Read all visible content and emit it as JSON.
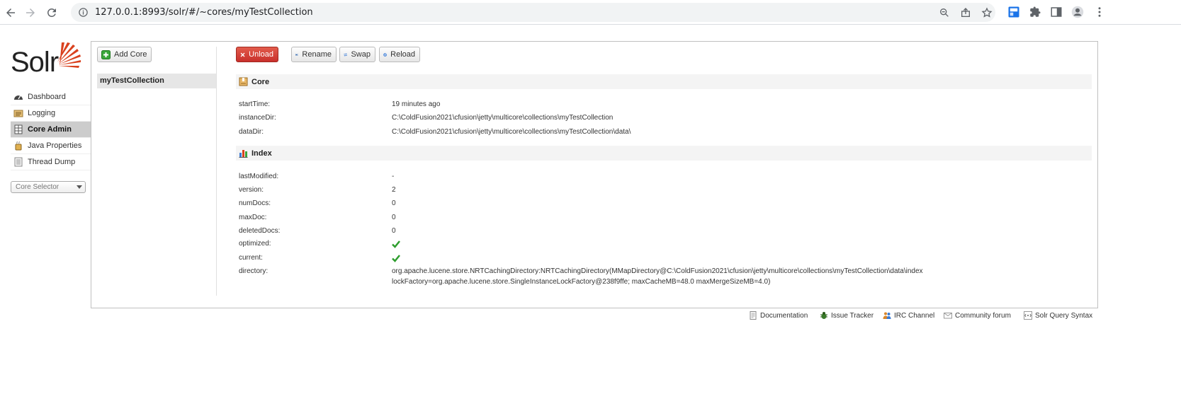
{
  "browser": {
    "url": "127.0.0.1:8993/solr/#/~cores/myTestCollection"
  },
  "logo": {
    "text": "Solr"
  },
  "menu": {
    "items": [
      {
        "label": "Dashboard",
        "icon": "dashboard-icon"
      },
      {
        "label": "Logging",
        "icon": "logging-icon"
      },
      {
        "label": "Core Admin",
        "icon": "core-admin-icon",
        "active": true
      },
      {
        "label": "Java Properties",
        "icon": "java-icon"
      },
      {
        "label": "Thread Dump",
        "icon": "thread-dump-icon"
      }
    ],
    "core_selector": "Core Selector"
  },
  "toolbar": {
    "add_core": "Add Core",
    "unload": "Unload",
    "rename": "Rename",
    "swap": "Swap",
    "reload": "Reload"
  },
  "cores": [
    "myTestCollection"
  ],
  "core_section": {
    "title": "Core",
    "rows": [
      {
        "key": "startTime:",
        "value": "19 minutes ago"
      },
      {
        "key": "instanceDir:",
        "value": "C:\\ColdFusion2021\\cfusion\\jetty\\multicore\\collections\\myTestCollection"
      },
      {
        "key": "dataDir:",
        "value": "C:\\ColdFusion2021\\cfusion\\jetty\\multicore\\collections\\myTestCollection\\data\\"
      }
    ]
  },
  "index_section": {
    "title": "Index",
    "rows": [
      {
        "key": "lastModified:",
        "value": "-"
      },
      {
        "key": "version:",
        "value": "2"
      },
      {
        "key": "numDocs:",
        "value": "0"
      },
      {
        "key": "maxDoc:",
        "value": "0"
      },
      {
        "key": "deletedDocs:",
        "value": "0"
      },
      {
        "key": "optimized:",
        "value": ""
      },
      {
        "key": "current:",
        "value": ""
      },
      {
        "key": "directory:",
        "value": "org.apache.lucene.store.NRTCachingDirectory:NRTCachingDirectory(MMapDirectory@C:\\ColdFusion2021\\cfusion\\jetty\\multicore\\collections\\myTestCollection\\data\\index",
        "value2": "lockFactory=org.apache.lucene.store.SingleInstanceLockFactory@238f9ffe; maxCacheMB=48.0 maxMergeSizeMB=4.0)"
      }
    ]
  },
  "footer": {
    "links": [
      {
        "label": "Documentation",
        "icon": "document-icon"
      },
      {
        "label": "Issue Tracker",
        "icon": "bug-icon"
      },
      {
        "label": "IRC Channel",
        "icon": "users-icon"
      },
      {
        "label": "Community forum",
        "icon": "mail-icon"
      },
      {
        "label": "Solr Query Syntax",
        "icon": "query-icon"
      }
    ]
  },
  "colors": {
    "active_menu": "#cccccc",
    "unload_red": "#c9302c",
    "check_green": "#2e9e2e",
    "solr_orange": "#d9411e"
  }
}
